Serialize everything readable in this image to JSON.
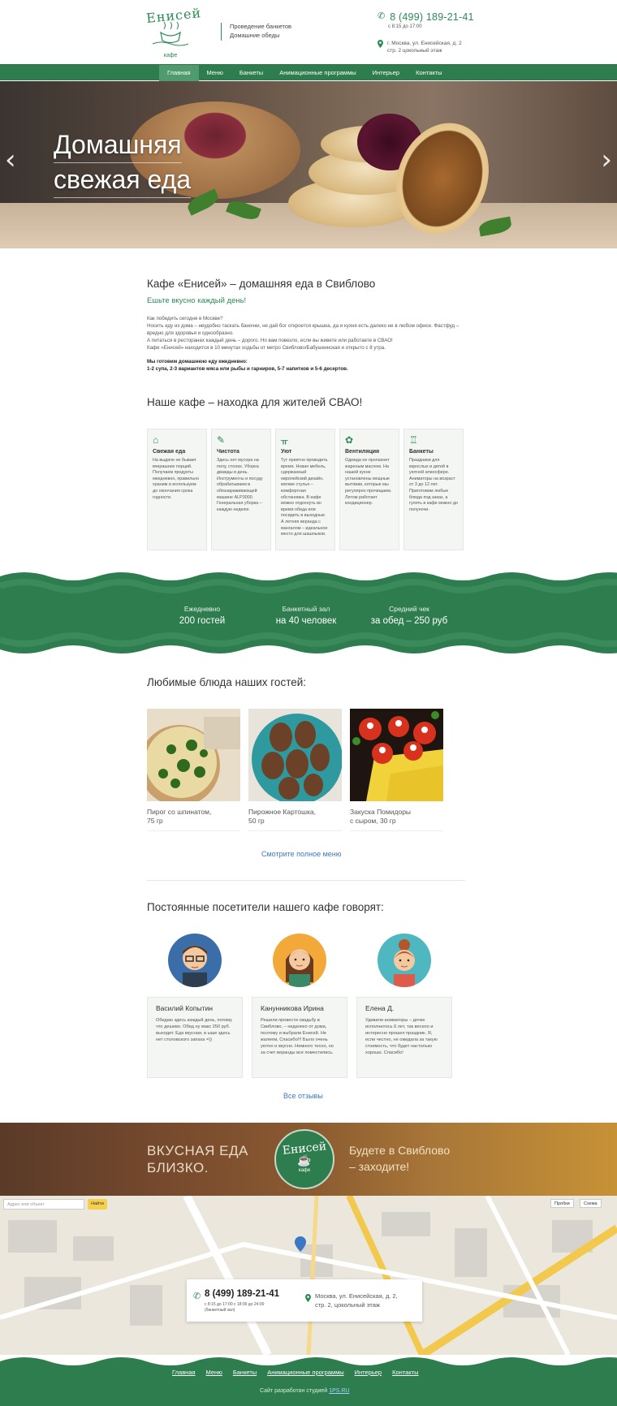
{
  "header": {
    "logo_word": "Енисей",
    "logo_sub": "кафе",
    "tagline": [
      "Проведение банкетов",
      "Домашние обеды"
    ],
    "phone": "8 (499) 189-21-41",
    "hours": "с 8:15 до 17:00",
    "address": [
      "г. Москва, ул. Енисейская, д. 2",
      "стр. 2 цокольный этаж"
    ]
  },
  "nav": {
    "items": [
      "Главная",
      "Меню",
      "Банкеты",
      "Анимационные программы",
      "Интерьер",
      "Контакты"
    ],
    "active": "Главная"
  },
  "hero": {
    "line1": "Домашняя",
    "line2": "свежая еда"
  },
  "intro": {
    "title": "Кафе «Енисей» – домашняя еда в Свиблово",
    "subtitle": "Ешьте вкусно каждый день!",
    "paragraph": "Как победить сегодня в Москве?\nНосить еду из дома – неудобно таскать баночки, не дай бог откроется крышка, да и кухня есть далеко не в любом офисе. Фастфуд – вредно для здоровья и однообразно.\nА питаться в ресторанах каждый день – дорого. Но вам повезло, если вы живете или работаете в СВАО!\nКафе «Енисей» находится в 10 минутах ходьбы от метро Свиблово/Бабушкинская и открыто с 8 утра.",
    "bold_title": "Мы готовим домашнюю еду ежедневно:",
    "bold_text": "1-2 супа, 2-3 вариантов мяса или рыбы и гарниров, 5-7 напитков и 5-6 десертов."
  },
  "features_title": "Наше кафе – находка для жителей СВАО!",
  "features": [
    {
      "icon": "house-icon",
      "title": "Свежая еда",
      "text": "На выдаче не бывает вчерашних порций. Получаем продукты ежедневно, правильно храним и используем до окончания срока годности."
    },
    {
      "icon": "cleaning-icon",
      "title": "Чистота",
      "text": "Здесь нет мусора на полу, столах. Уборка дважды в день. Инструменты и посуду обрабатываем в обеззараживающей машине ALP3000. Генеральная уборка – каждую неделю."
    },
    {
      "icon": "cafe-icon",
      "title": "Уют",
      "text": "Тут приятно проводить время. Новая мебель, сдержанный европейский дизайн, мягкие стулья – комфортная обстановка. В кафе можно отдохнуть во время обеда или посидеть в выходные. А летняя веранда с мангалом – идеальное место для шашлыков."
    },
    {
      "icon": "fan-icon",
      "title": "Вентиляция",
      "text": "Одежда не пропахнет жареным маслом. На нашей кухне установлены мощные вытяжки, которые мы регулярно прочищаем. Летом работает кондиционер."
    },
    {
      "icon": "glass-icon",
      "title": "Банкеты",
      "text": "Праздники для взрослых и детей в уютной атмосфере. Аниматоры на возраст от 3 до 12 лет. Приготовим любые блюда под заказ, а гулять в кафе можно до полуночи."
    }
  ],
  "stats": [
    {
      "label": "Ежедневно",
      "value": "200 гостей"
    },
    {
      "label": "Банкетный зал",
      "value": "на 40 человек"
    },
    {
      "label": "Средний чек",
      "value": "за обед – 250 руб"
    }
  ],
  "dishes_title": "Любимые блюда наших гостей:",
  "dishes": [
    {
      "name": "Пирог со шпинатом,\n75 гр"
    },
    {
      "name": "Пирожное Картошка,\n50 гр"
    },
    {
      "name": "Закуска Помидоры\nс сыром, 30 гр"
    }
  ],
  "menu_link": "Смотрите полное меню",
  "reviews_title": "Постоянные посетители нашего кафе говорят:",
  "reviews": [
    {
      "name": "Василий Копытин",
      "text": "Обедаю здесь каждый день, потому что дешево. Обед ну макс 250 руб. выходит. Еда вкусная, в ыше здесь нет столовского запаха =))"
    },
    {
      "name": "Канунникова Ирина",
      "text": "Решили провести свадьбу в Свиблово, – недалеко от дома, поэтому и выбрали Енисей. Не жалеем, Спасибо!!! Было очень уютно и вкусно. Немного тесно, но за счет веранды все поместились."
    },
    {
      "name": "Елена Д.",
      "text": "Удивили аниматоры – дочке исполнилось 6 лет, так весело и интересно прошел праздник. Я, если честно, не ожидала за такую стоимость, что будет настолько хорошо. Спасибо!"
    }
  ],
  "all_reviews": "Все отзывы",
  "banner": {
    "left1": "ВКУСНАЯ ЕДА",
    "left2": "БЛИЗКО.",
    "badge_word": "Енисей",
    "badge_sub": "кафе",
    "right1": "Будете в Свиблово",
    "right2": "– заходите!"
  },
  "map": {
    "search_placeholder": "Адрес или объект",
    "find_button": "Найти",
    "traffic": "Пробки",
    "layers": "Схема"
  },
  "contact": {
    "phone": "8 (499) 189-21-41",
    "hours1": "с 8:15 до 17:00   с 18:00 до 24:00",
    "hours2": "(банкетный зал)",
    "address1": "Москва, ул. Енисейская, д. 2,",
    "address2": "стр. 2, цокольный этаж"
  },
  "footer": {
    "links": [
      "Главная",
      "Меню",
      "Банкеты",
      "Анимационные программы",
      "Интерьер",
      "Контакты"
    ],
    "credit_text": "Сайт разработан студией",
    "credit_link": "1PS.RU"
  },
  "colors": {
    "brand_green": "#2e7d4f",
    "link_blue": "#3a78c4"
  }
}
